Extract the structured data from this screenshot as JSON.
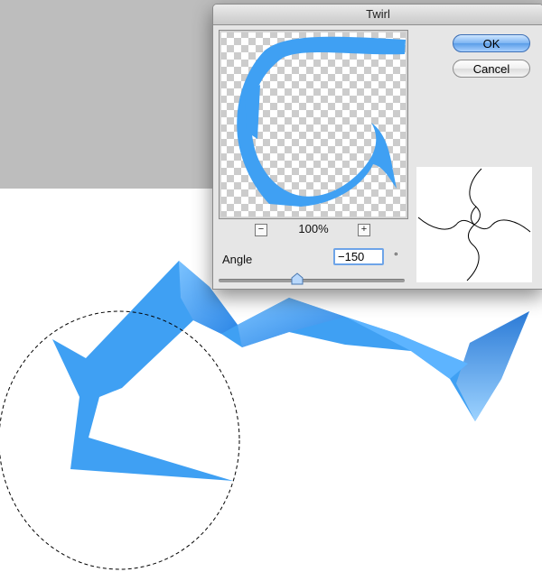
{
  "dialog": {
    "title": "Twirl",
    "ok_label": "OK",
    "cancel_label": "Cancel",
    "zoom": {
      "minus": "−",
      "value": "100%",
      "plus": "+"
    },
    "angle": {
      "label": "Angle",
      "value": "−150",
      "unit": "°"
    }
  },
  "colors": {
    "shape_blue": "#3fa0f3",
    "button_accent": "#6fadf0"
  }
}
